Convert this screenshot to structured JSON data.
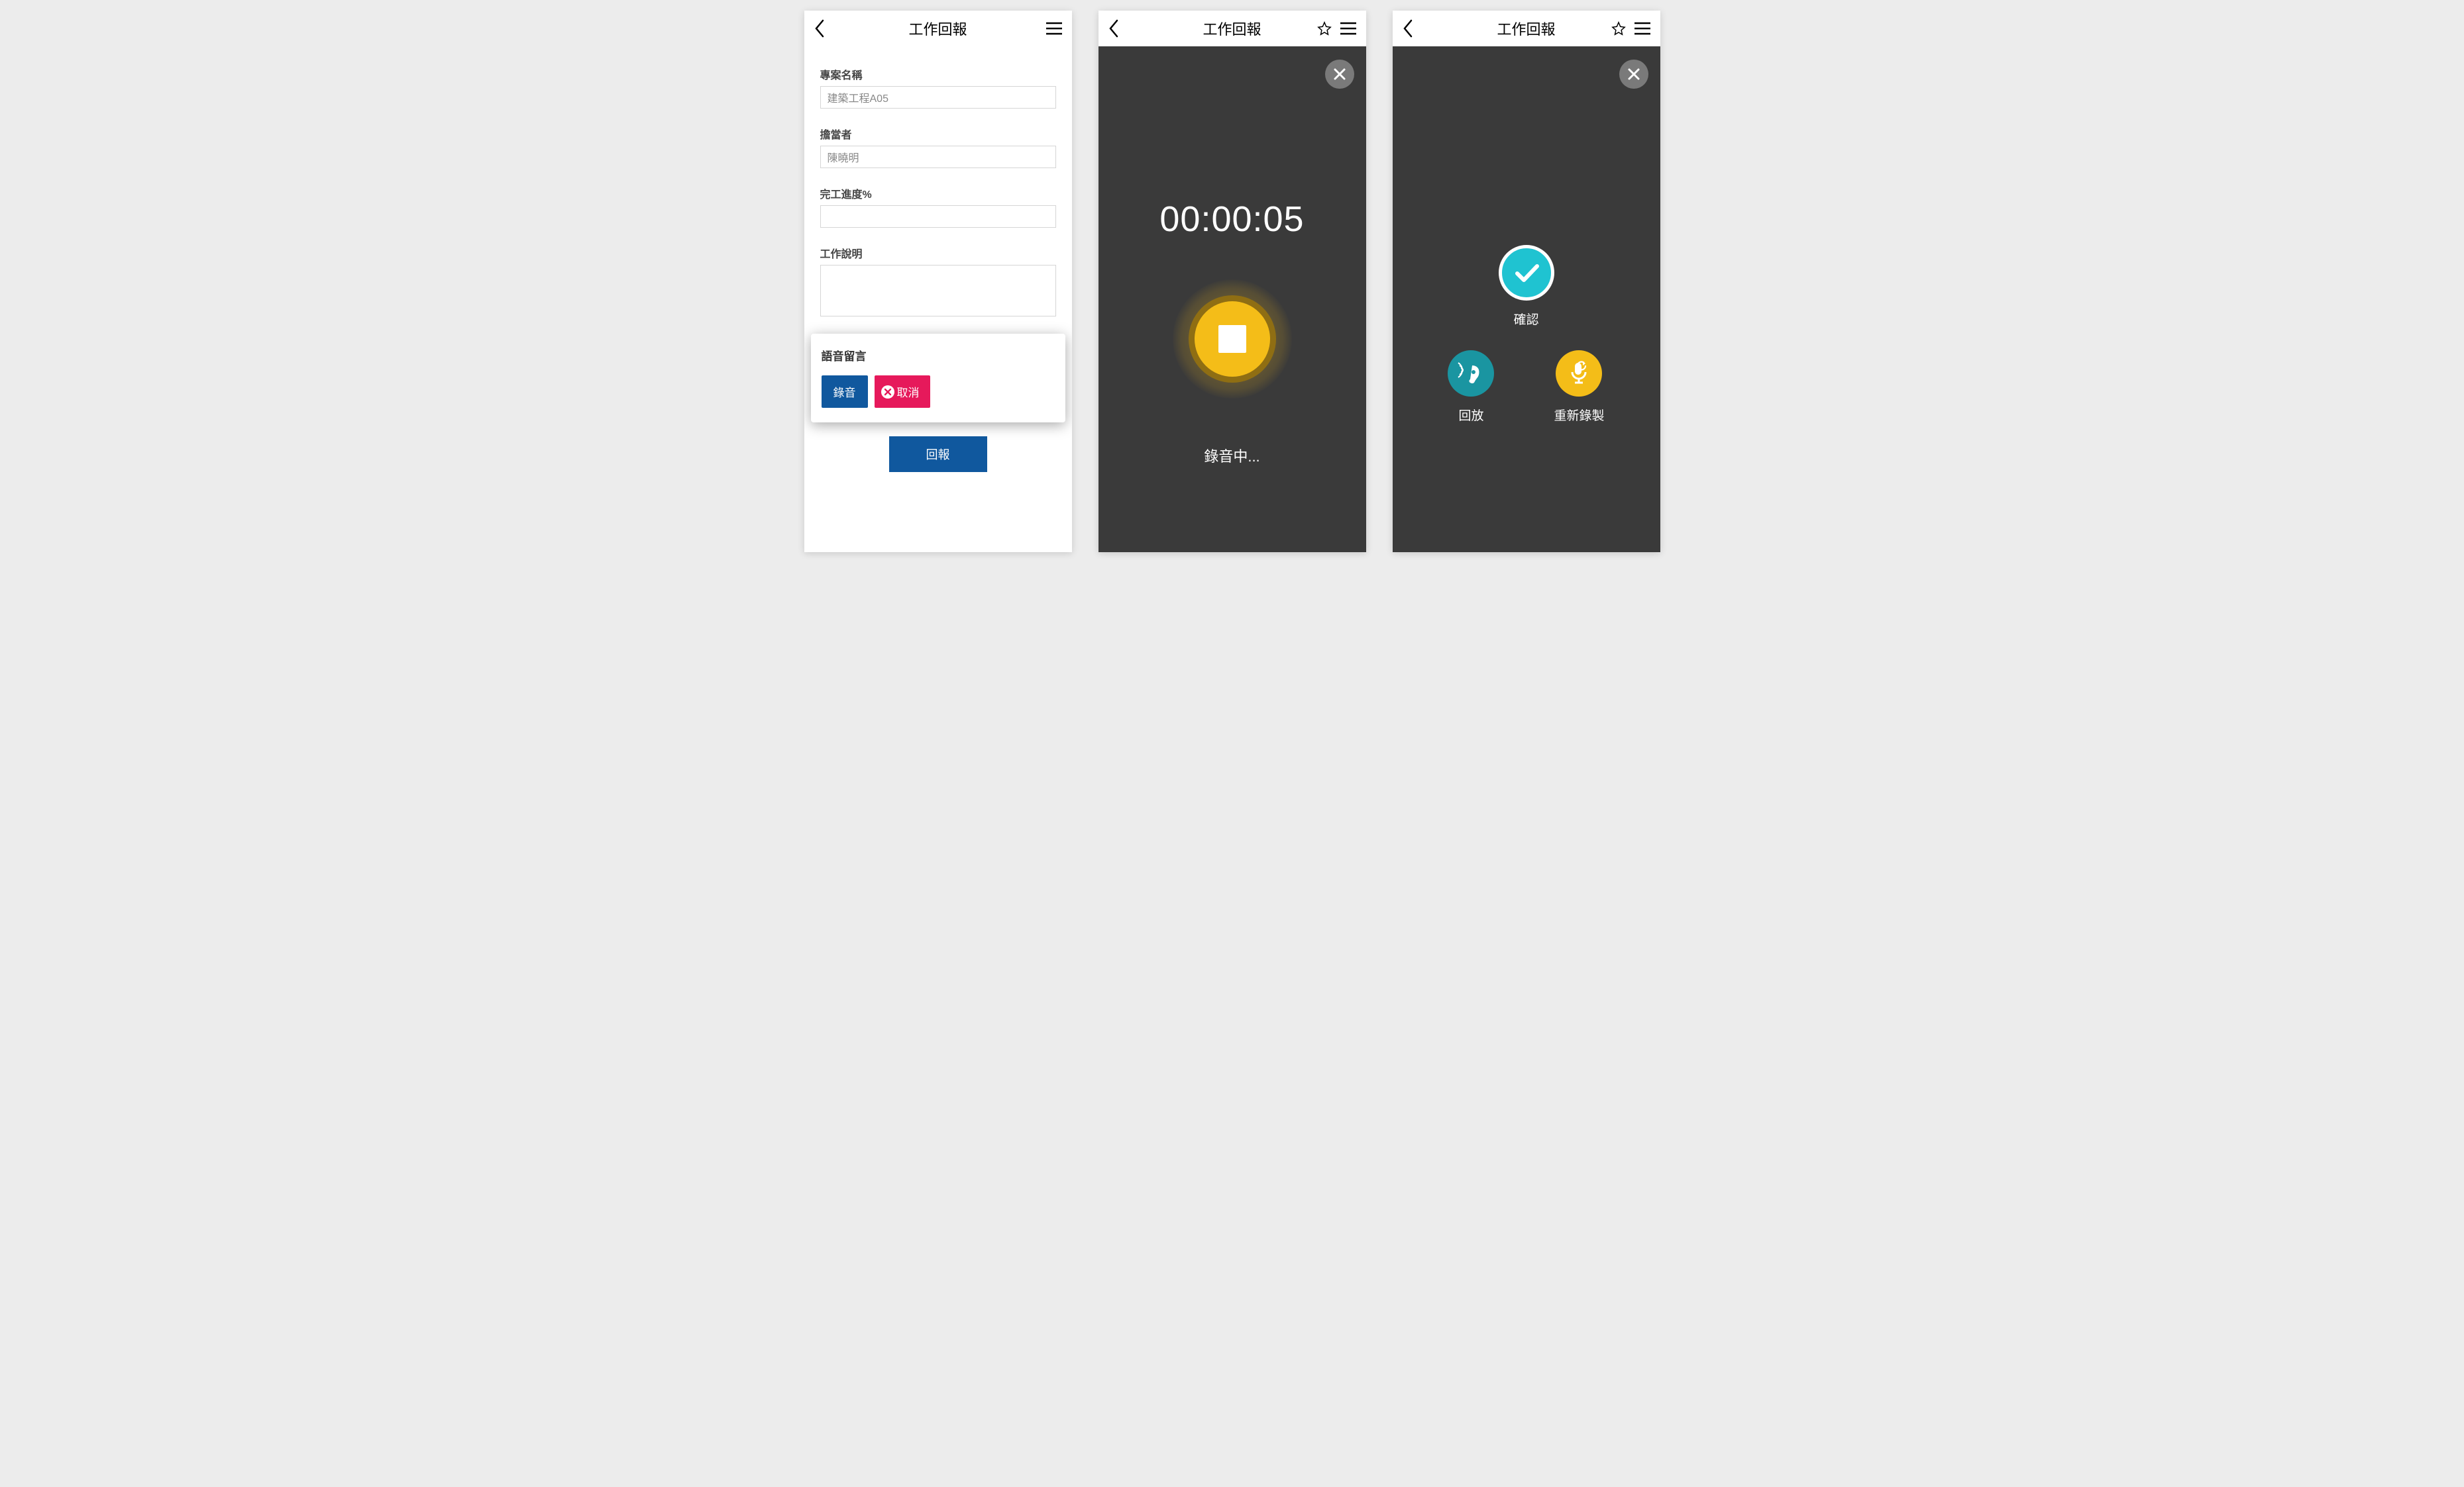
{
  "header": {
    "title": "工作回報"
  },
  "form": {
    "project_label": "專案名稱",
    "project_value": "建築工程A05",
    "owner_label": "擔當者",
    "owner_value": "陳曉明",
    "progress_label": "完工進度%",
    "progress_value": "",
    "desc_label": "工作說明",
    "desc_value": "",
    "submit_label": "回報"
  },
  "voice_popup": {
    "title": "語音留言",
    "record_label": "錄音",
    "cancel_label": "取消"
  },
  "recording": {
    "timer": "00:00:05",
    "status": "錄音中..."
  },
  "finished": {
    "confirm_label": "確認",
    "replay_label": "回放",
    "rerecord_label": "重新錄製"
  }
}
